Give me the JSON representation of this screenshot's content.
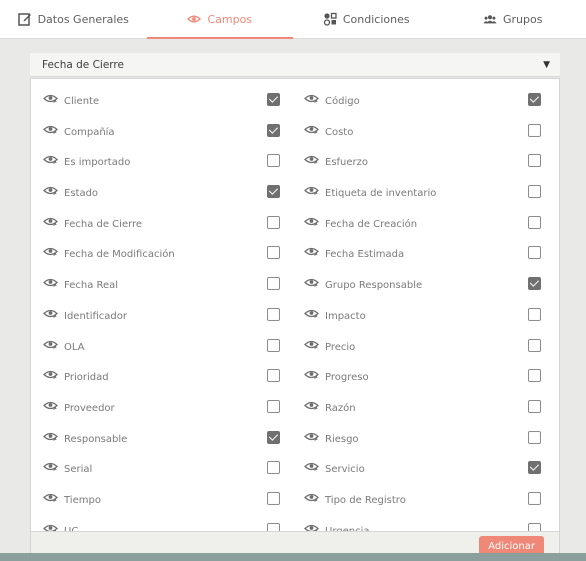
{
  "tabs": [
    {
      "label": "Datos Generales",
      "icon": "edit-icon",
      "active": false
    },
    {
      "label": "Campos",
      "icon": "eye-icon",
      "active": true
    },
    {
      "label": "Condiciones",
      "icon": "conditions-icon",
      "active": false
    },
    {
      "label": "Grupos",
      "icon": "group-icon",
      "active": false
    }
  ],
  "select": {
    "value": "Fecha de Cierre"
  },
  "fields": [
    {
      "label": "Cliente",
      "checked": true
    },
    {
      "label": "Código",
      "checked": true
    },
    {
      "label": "Compañía",
      "checked": true
    },
    {
      "label": "Costo",
      "checked": false
    },
    {
      "label": "Es importado",
      "checked": false
    },
    {
      "label": "Esfuerzo",
      "checked": false
    },
    {
      "label": "Estado",
      "checked": true
    },
    {
      "label": "Etiqueta de inventario",
      "checked": false
    },
    {
      "label": "Fecha de Cierre",
      "checked": false
    },
    {
      "label": "Fecha de Creación",
      "checked": false
    },
    {
      "label": "Fecha de Modificación",
      "checked": false
    },
    {
      "label": "Fecha Estimada",
      "checked": false
    },
    {
      "label": "Fecha Real",
      "checked": false
    },
    {
      "label": "Grupo Responsable",
      "checked": true
    },
    {
      "label": "Identificador",
      "checked": false
    },
    {
      "label": "Impacto",
      "checked": false
    },
    {
      "label": "OLA",
      "checked": false
    },
    {
      "label": "Precio",
      "checked": false
    },
    {
      "label": "Prioridad",
      "checked": false
    },
    {
      "label": "Progreso",
      "checked": false
    },
    {
      "label": "Proveedor",
      "checked": false
    },
    {
      "label": "Razón",
      "checked": false
    },
    {
      "label": "Responsable",
      "checked": true
    },
    {
      "label": "Riesgo",
      "checked": false
    },
    {
      "label": "Serial",
      "checked": false
    },
    {
      "label": "Servicio",
      "checked": true
    },
    {
      "label": "Tiempo",
      "checked": false
    },
    {
      "label": "Tipo de Registro",
      "checked": false
    },
    {
      "label": "UC",
      "checked": false
    },
    {
      "label": "Urgencia",
      "checked": false
    }
  ],
  "footer": {
    "add_label": "Adicionar"
  },
  "colors": {
    "accent": "#ef8877",
    "checkbox_checked": "#707070"
  }
}
